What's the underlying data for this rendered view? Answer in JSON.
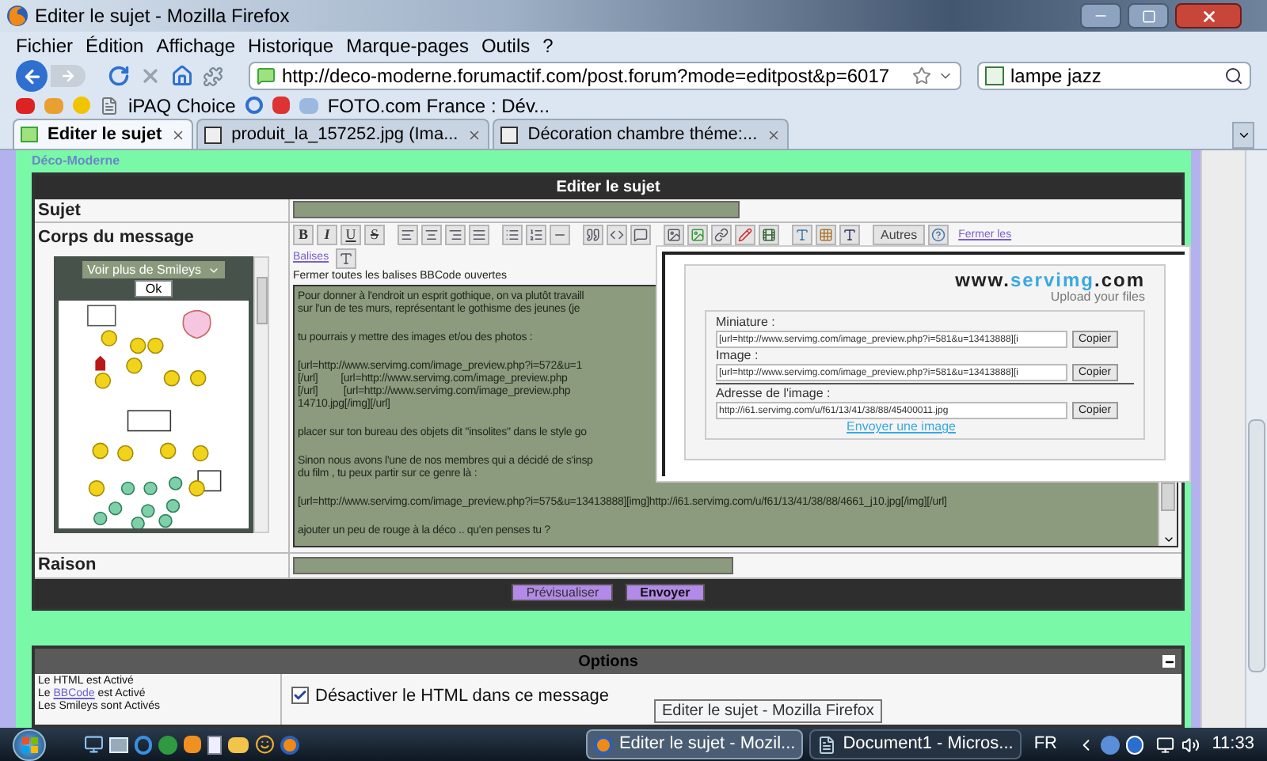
{
  "window": {
    "title": "Editer le sujet - Mozilla Firefox"
  },
  "menu": [
    "Fichier",
    "Édition",
    "Affichage",
    "Historique",
    "Marque-pages",
    "Outils",
    "?"
  ],
  "address_bar": {
    "value": "http://deco-moderne.forumactif.com/post.forum?mode=editpost&p=6017"
  },
  "search": {
    "value": "lampe jazz"
  },
  "bookmarks": [
    {
      "label": "iPAQ Choice"
    },
    {
      "label": "FOTO.com France : Dév..."
    }
  ],
  "tabs": [
    {
      "label": "Editer le sujet",
      "selected": true
    },
    {
      "label": "produit_la_157252.jpg (Ima...",
      "selected": false
    },
    {
      "label": "Décoration chambre théme:...",
      "selected": false
    }
  ],
  "page": {
    "site_name": "Déco-Moderne",
    "form": {
      "title": "Editer le sujet",
      "subject_label": "Sujet",
      "body_label": "Corps du message",
      "smileys": {
        "select": "Voir plus de Smileys",
        "ok": "Ok"
      },
      "format_buttons": [
        {
          "label": "B",
          "kind": "bold"
        },
        {
          "label": "I",
          "kind": "italic"
        },
        {
          "label": "U",
          "kind": "underline"
        },
        {
          "label": "S",
          "kind": "strike"
        }
      ],
      "other_button": "Autres",
      "close_link": "Fermer les",
      "tags_link": "Balises",
      "close_tags": "Fermer toutes les balises BBCode ouvertes",
      "body_paragraphs": [
        [
          "Pour donner à l'endroit un esprit gothique, on va plutôt travaill",
          "sur l'un de tes murs, représentant le gothisme des jeunes (je"
        ],
        [
          "tu pourrais y mettre des images et/ou des photos :"
        ],
        [
          "[url=http://www.servimg.com/image_preview.php?i=572&u=1",
          "[/url]        [url=http://www.servimg.com/image_preview.php",
          "[/url]         [url=http://www.servimg.com/image_preview.php",
          "14710.jpg[/img][/url]"
        ],
        [
          "placer sur ton bureau des objets dit \"insolites\" dans le style go"
        ],
        [
          "Sinon nous avons l'une de nos membres qui a décidé de s'insp",
          "du film , tu peux partir sur ce genre là :"
        ],
        [
          "[url=http://www.servimg.com/image_preview.php?i=575&u=13413888][img]http://i61.servimg.com/u/f61/13/41/38/88/4661_j10.jpg[/img][/url]"
        ],
        [
          "ajouter un peu de rouge à la déco .. qu'en penses tu ?"
        ]
      ],
      "reason_label": "Raison",
      "buttons": [
        {
          "label": "Prévisualiser",
          "kind": "secondary"
        },
        {
          "label": "Envoyer",
          "kind": "primary"
        }
      ]
    },
    "options": {
      "title": "Options",
      "status_lines": [
        {
          "before": "Le HTML est Activé"
        },
        {
          "before": "Le",
          "link": "BBCode",
          "after": "est Activé"
        },
        {
          "before": "Les Smileys sont Activés"
        }
      ],
      "checkbox": {
        "label": "Désactiver le HTML dans ce message",
        "checked": true
      }
    }
  },
  "upload_popup": {
    "logo": {
      "prefix": "www.",
      "name": "servimg",
      "suffix": ".com"
    },
    "tagline": "Upload your files",
    "fields": [
      {
        "label": "Miniature :",
        "value": "[url=http://www.servimg.com/image_preview.php?i=581&u=13413888][i",
        "button": "Copier"
      },
      {
        "label": "Image :",
        "value": "[url=http://www.servimg.com/image_preview.php?i=581&u=13413888][i",
        "button": "Copier"
      },
      {
        "label": "Adresse de l'image :",
        "value": "http://i61.servimg.com/u/f61/13/41/38/88/45400011.jpg",
        "button": "Copier"
      }
    ],
    "upload_link": "Envoyer une image"
  },
  "tooltip": "Editer le sujet - Mozilla Firefox",
  "taskbar": {
    "tasks": [
      {
        "label": "Editer le sujet - Mozil...",
        "selected": true
      },
      {
        "label": "Document1 - Micros...",
        "selected": false
      }
    ],
    "language": "FR",
    "clock": "11:33"
  }
}
